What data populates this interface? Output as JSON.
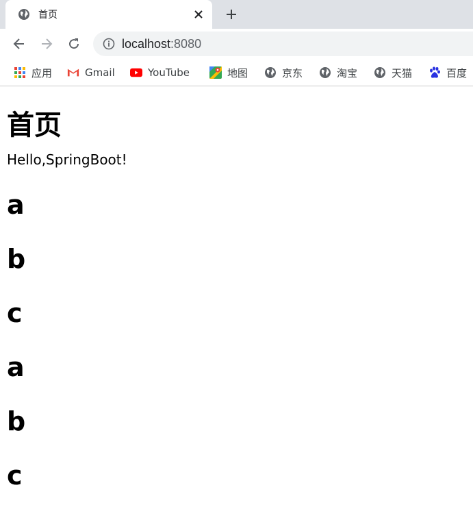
{
  "browser": {
    "tab": {
      "title": "首页",
      "icon": "globe-icon"
    },
    "address": {
      "host": "localhost",
      "port": ":8080"
    },
    "bookmarks": [
      {
        "label": "应用",
        "icon": "apps-grid-icon"
      },
      {
        "label": "Gmail",
        "icon": "gmail-icon"
      },
      {
        "label": "YouTube",
        "icon": "youtube-icon"
      },
      {
        "label": "地图",
        "icon": "maps-icon"
      },
      {
        "label": "京东",
        "icon": "globe-icon"
      },
      {
        "label": "淘宝",
        "icon": "globe-icon"
      },
      {
        "label": "天猫",
        "icon": "globe-icon"
      },
      {
        "label": "百度",
        "icon": "baidu-paw-icon"
      }
    ]
  },
  "page": {
    "heading": "首页",
    "greeting": "Hello,SpringBoot!",
    "items": [
      "a",
      "b",
      "c",
      "a",
      "b",
      "c"
    ]
  }
}
